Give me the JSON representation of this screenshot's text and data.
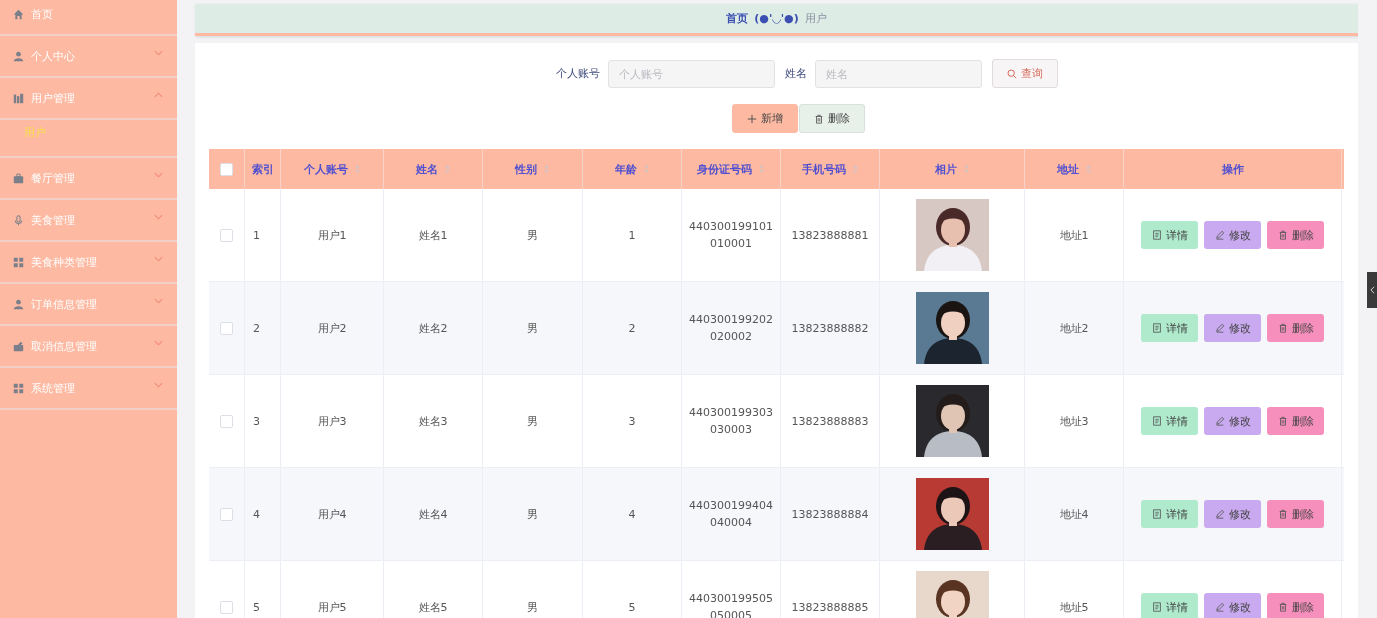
{
  "sidebar": {
    "items": [
      {
        "label": "首页"
      },
      {
        "label": "个人中心",
        "expanded": false
      },
      {
        "label": "用户管理",
        "expanded": true,
        "children": [
          {
            "label": "用户",
            "selected": true
          }
        ]
      },
      {
        "label": "餐厅管理",
        "expanded": false
      },
      {
        "label": "美食管理",
        "expanded": false
      },
      {
        "label": "美食种类管理",
        "expanded": false
      },
      {
        "label": "订单信息管理",
        "expanded": false
      },
      {
        "label": "取消信息管理",
        "expanded": false
      },
      {
        "label": "系统管理",
        "expanded": false
      }
    ]
  },
  "breadcrumb": {
    "home": "首页",
    "separator": "(●'◡'●)",
    "current": "用户"
  },
  "search": {
    "fields": [
      {
        "label": "个人账号",
        "placeholder": "个人账号"
      },
      {
        "label": "姓名",
        "placeholder": "姓名"
      }
    ],
    "button": "查询"
  },
  "actions": {
    "add": "新增",
    "delete": "删除"
  },
  "table": {
    "header_checked": false,
    "columns": [
      {
        "label": "索引",
        "sortable": false
      },
      {
        "label": "个人账号",
        "sortable": true
      },
      {
        "label": "姓名",
        "sortable": true
      },
      {
        "label": "性别",
        "sortable": true
      },
      {
        "label": "年龄",
        "sortable": true
      },
      {
        "label": "身份证号码",
        "sortable": true
      },
      {
        "label": "手机号码",
        "sortable": true
      },
      {
        "label": "相片",
        "sortable": true
      },
      {
        "label": "地址",
        "sortable": true
      },
      {
        "label": "操作",
        "sortable": false
      }
    ],
    "rows": [
      {
        "checked": false,
        "index": "1",
        "account": "用户1",
        "name": "姓名1",
        "gender": "男",
        "age": "1",
        "id_number": "440300199101010001",
        "phone": "13823888881",
        "address": "地址1",
        "buttons": [
          "详情",
          "修改",
          "删除"
        ]
      },
      {
        "checked": false,
        "index": "2",
        "account": "用户2",
        "name": "姓名2",
        "gender": "男",
        "age": "2",
        "id_number": "440300199202020002",
        "phone": "13823888882",
        "address": "地址2",
        "buttons": [
          "详情",
          "修改",
          "删除"
        ]
      },
      {
        "checked": false,
        "index": "3",
        "account": "用户3",
        "name": "姓名3",
        "gender": "男",
        "age": "3",
        "id_number": "440300199303030003",
        "phone": "13823888883",
        "address": "地址3",
        "buttons": [
          "详情",
          "修改",
          "删除"
        ]
      },
      {
        "checked": false,
        "index": "4",
        "account": "用户4",
        "name": "姓名4",
        "gender": "男",
        "age": "4",
        "id_number": "440300199404040004",
        "phone": "13823888884",
        "address": "地址4",
        "buttons": [
          "详情",
          "修改",
          "删除"
        ]
      },
      {
        "checked": false,
        "index": "5",
        "account": "用户5",
        "name": "姓名5",
        "gender": "男",
        "age": "5",
        "id_number": "440300199505050005",
        "phone": "13823888885",
        "address": "地址5",
        "buttons": [
          "详情",
          "修改",
          "删除"
        ]
      }
    ]
  }
}
